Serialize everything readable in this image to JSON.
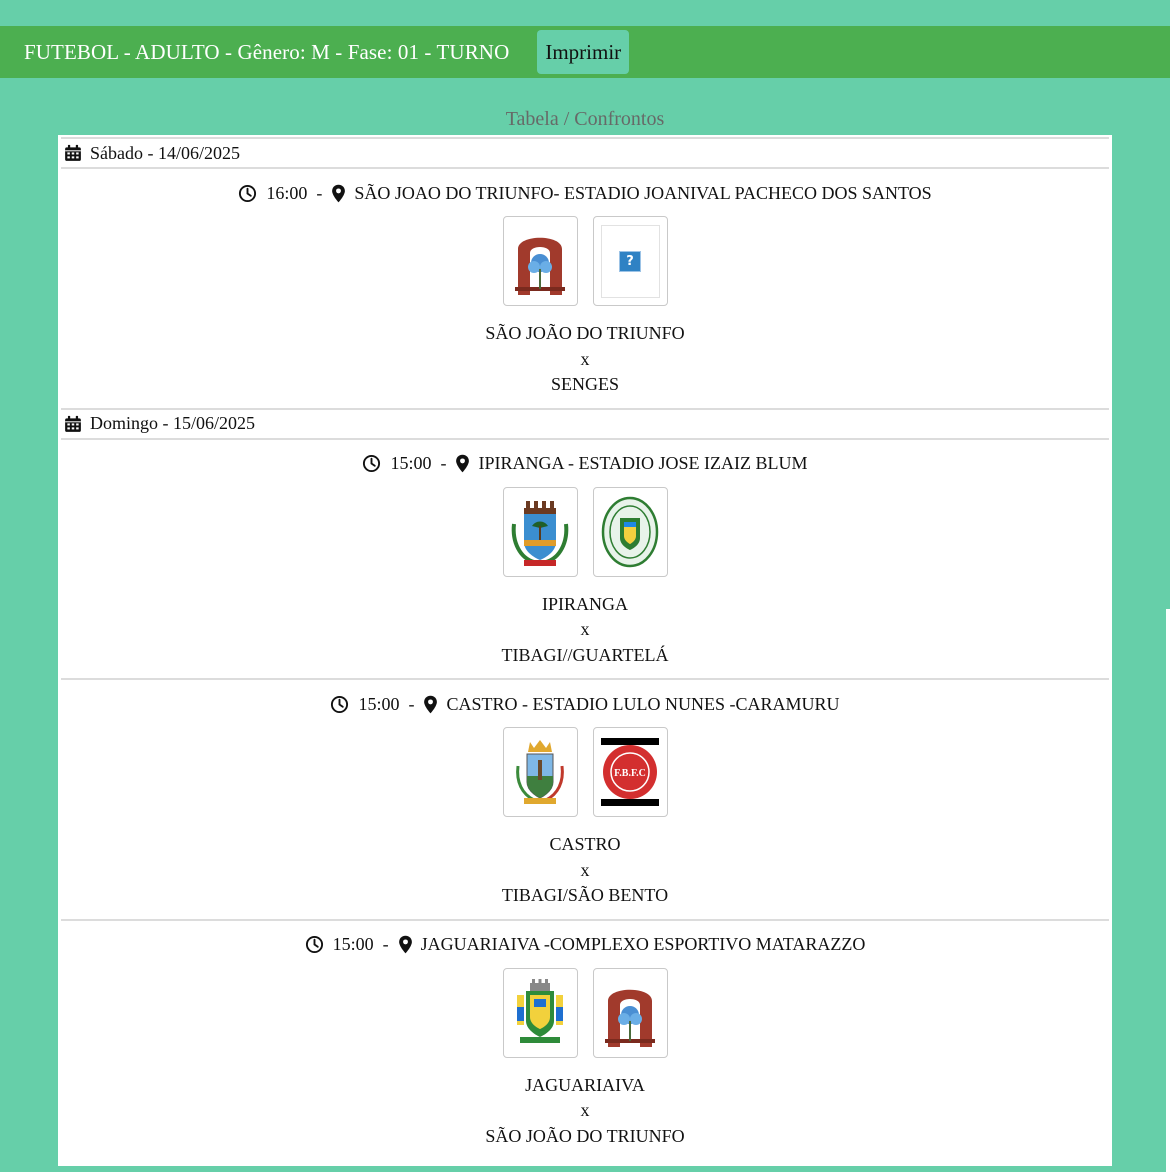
{
  "header": {
    "title": "FUTEBOL - ADULTO - Gênero: M - Fase: 01 - TURNO",
    "print_label": "Imprimir"
  },
  "section_title": "Tabela / Confrontos",
  "colors": {
    "page_bg": "#66cfa9",
    "topbar_bg": "#4caf50",
    "panel_bg": "#ffffff"
  },
  "days": [
    {
      "label": "Sábado - 14/06/2025",
      "matches": [
        {
          "time": "16:00",
          "separator": "-",
          "venue": "SÃO JOAO DO TRIUNFO- ESTADIO JOANIVAL PACHECO DOS SANTOS",
          "home": "SÃO JOÃO DO TRIUNFO",
          "vs": "x",
          "away": "SENGES",
          "home_logo": "arch-crest-icon",
          "away_logo": "missing-image-icon"
        }
      ]
    },
    {
      "label": "Domingo - 15/06/2025",
      "matches": [
        {
          "time": "15:00",
          "separator": "-",
          "venue": "IPIRANGA - ESTADIO JOSE IZAIZ BLUM",
          "home": "IPIRANGA",
          "vs": "x",
          "away": "TIBAGI//GUARTELÁ",
          "home_logo": "castle-tree-crest-icon",
          "away_logo": "oval-crest-icon"
        },
        {
          "time": "15:00",
          "separator": "-",
          "venue": "CASTRO - ESTADIO LULO NUNES -CARAMURU",
          "home": "CASTRO",
          "vs": "x",
          "away": "TIBAGI/SÃO BENTO",
          "home_logo": "shield-crest-icon",
          "away_logo": "fbfc-badge-icon",
          "away_logo_text": "F.B.F.C"
        },
        {
          "time": "15:00",
          "separator": "-",
          "venue": "JAGUARIAIVA -COMPLEXO ESPORTIVO MATARAZZO",
          "home": "JAGUARIAIVA",
          "vs": "x",
          "away": "SÃO JOÃO DO TRIUNFO",
          "home_logo": "coat-of-arms-icon",
          "away_logo": "arch-crest-icon"
        }
      ]
    }
  ]
}
